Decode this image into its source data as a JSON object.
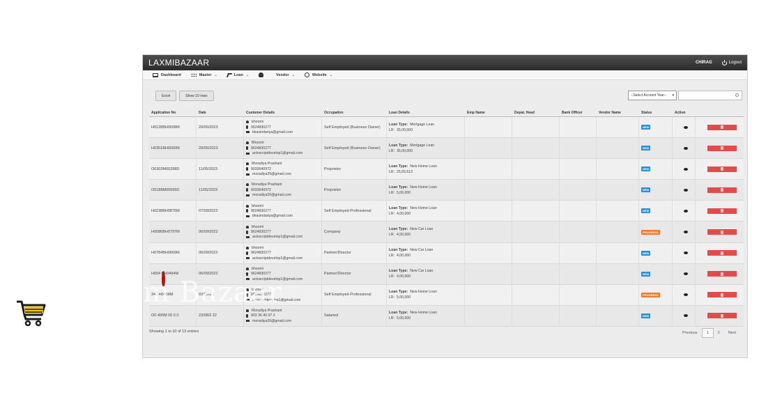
{
  "header": {
    "brand": "LAXMIBAZAAR",
    "user": "CHIRAG",
    "logout_label": "Logout"
  },
  "menu": [
    {
      "label": "Dashboard",
      "icon": "monitor-icon",
      "dropdown": false
    },
    {
      "label": "Master",
      "icon": "grid-icon",
      "dropdown": true
    },
    {
      "label": "Loan",
      "icon": "tools-icon",
      "dropdown": true
    },
    {
      "label": "Vendor",
      "icon": "user-icon",
      "dropdown": true
    },
    {
      "label": "Website",
      "icon": "globe-icon",
      "dropdown": true
    }
  ],
  "toolbar": {
    "excel_label": "Excel",
    "rows_label": "Show 10 rows"
  },
  "filters": {
    "account_year": "--Select Account Year--",
    "search_placeholder": ""
  },
  "table": {
    "columns": [
      "Application No",
      "Date",
      "Customer Details",
      "Occupation",
      "Loan Details",
      "Emp Name",
      "Depat. Head",
      "Bank Officer",
      "Vendor Name",
      "Status",
      "Action"
    ],
    "rows": [
      {
        "app_no": "H0128BH0608M",
        "date": "29/05/2023",
        "name": "bhoomi",
        "phone": "9624830277",
        "email": "bkasindariya@gmail.com",
        "occupation": "Self Employed (Business Owner)",
        "loan_type": "Mortgage Loan",
        "lr": "35,00,000",
        "status": "NEW"
      },
      {
        "app_no": "H0351BH0000M",
        "date": "29/05/2023",
        "name": "Bhoomi",
        "phone": "9624830277",
        "email": "actoscriptdevelop1@gmail.com",
        "occupation": "Self Employed (Business Owner)",
        "loan_type": "Mortgage Loan",
        "lr": "35,00,000",
        "status": "NEW"
      },
      {
        "app_no": "O0303M00298D",
        "date": "11/05/2023",
        "name": "Moradiya Prashant",
        "phone": "9033640972",
        "email": "moradiya26@gmail.com",
        "occupation": "Proprietor",
        "loan_type": "New Home Loan",
        "lr": "25,65,613",
        "status": "NEW"
      },
      {
        "app_no": "O0188M00695D",
        "date": "11/05/2023",
        "name": "Moradiya Prashant",
        "phone": "9033640972",
        "email": "moradiya26@gmail.com",
        "occupation": "Proprietor",
        "loan_type": "New Home Loan",
        "lr": "5,00,000",
        "status": "NEW"
      },
      {
        "app_no": "H0238BH0876M",
        "date": "07/09/2022",
        "name": "bhoomi",
        "phone": "9624830277",
        "email": "bkasindariya@gmail.com",
        "occupation": "Self Employed-Professional",
        "loan_type": "New Home Loan",
        "lr": "4,00,000",
        "status": "NEW"
      },
      {
        "app_no": "H0086BH0797M",
        "date": "06/09/2022",
        "name": "bhoomi",
        "phone": "9624830277",
        "email": "actoscriptdevelop1@gmail.com",
        "occupation": "Company",
        "loan_type": "New Car Loan",
        "lr": "4,00,000",
        "status": "PROGRESS"
      },
      {
        "app_no": "H0784BH0669M",
        "date": "06/09/2022",
        "name": "bhoomi",
        "phone": "9624830277",
        "email": "actoscriptdevelop1@gmail.com",
        "occupation": "Partner/Director",
        "loan_type": "New Car Loan",
        "lr": "4,00,000",
        "status": "NEW"
      },
      {
        "app_no": "H094 BH0494M",
        "date": "06/09/2022",
        "name": "bhoomi",
        "phone": "9624830277",
        "email": "actoscriptdevelop1@gmail.com",
        "occupation": "Partner/Director",
        "loan_type": "New Car Loan",
        "lr": "4,00,000",
        "status": "NEW"
      },
      {
        "app_no": "349 H0458M",
        "date": "03/09/2 2",
        "name": "bhoomi",
        "phone": "9624830277",
        "email": "ctoscriptdevelop1@gmail.com",
        "occupation": "Self Employed-Professional",
        "loan_type": "New Home Loan",
        "lr": "5,00,000",
        "status": "PROGRESS"
      },
      {
        "app_no": "O0 406M 00 0 0",
        "date": "23/08/2 22",
        "name": "Moradiya Prashant",
        "phone": "903 36 40 97 2",
        "email": "moradiya26@gmail.com",
        "occupation": "Salaried",
        "loan_type": "New Home Loan",
        "lr": "5,00,000",
        "status": "NEW"
      }
    ],
    "loan_type_label": "Loan Type:",
    "lr_label": "LR:"
  },
  "footer": {
    "info": "Showing 1 to 10 of 13 entries",
    "previous": "Previous",
    "pages": [
      "1",
      "2"
    ],
    "next": "Next"
  },
  "watermark": {
    "text": "m Bazaar"
  },
  "colors": {
    "new": "#2a8fd6",
    "progress": "#f07a2a",
    "delete": "#e24b4b",
    "topbar": "#3a3a3a"
  }
}
